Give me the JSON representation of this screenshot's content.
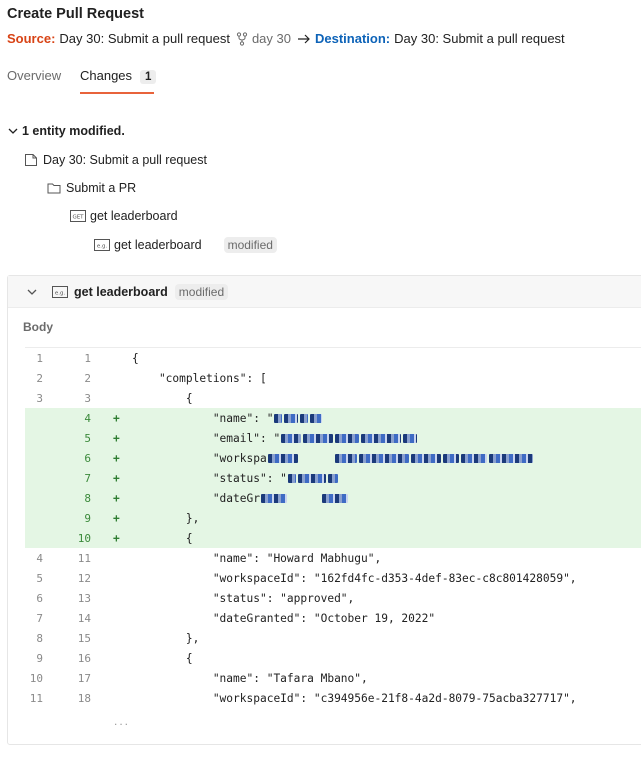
{
  "header": {
    "title": "Create Pull Request",
    "source_label": "Source:",
    "source_value": "Day 30: Submit a pull request",
    "source_branch": "day 30",
    "destination_label": "Destination:",
    "destination_value": "Day 30: Submit a pull request"
  },
  "tabs": [
    {
      "label": "Overview"
    },
    {
      "label": "Changes",
      "count": "1"
    }
  ],
  "tree": {
    "summary": "1 entity modified.",
    "collection": "Day 30: Submit a pull request",
    "folder": "Submit a PR",
    "request": "get leaderboard",
    "example": "get leaderboard",
    "example_status": "modified"
  },
  "panel": {
    "name": "get leaderboard",
    "status": "modified",
    "body_label": "Body",
    "ellipsis": "...",
    "lines": [
      {
        "old": "1",
        "new": "1",
        "sign": "",
        "code": "{"
      },
      {
        "old": "2",
        "new": "2",
        "sign": "",
        "code": "    \"completions\": ["
      },
      {
        "old": "3",
        "new": "3",
        "sign": "",
        "code": "        {"
      },
      {
        "old": "",
        "new": "4",
        "sign": "+",
        "code": "            \"name\": \""
      },
      {
        "old": "",
        "new": "5",
        "sign": "+",
        "code": "            \"email\": \""
      },
      {
        "old": "",
        "new": "6",
        "sign": "+",
        "code": "            \"workspa"
      },
      {
        "old": "",
        "new": "7",
        "sign": "+",
        "code": "            \"status\": \""
      },
      {
        "old": "",
        "new": "8",
        "sign": "+",
        "code": "            \"dateGr"
      },
      {
        "old": "",
        "new": "9",
        "sign": "+",
        "code": "        },"
      },
      {
        "old": "",
        "new": "10",
        "sign": "+",
        "code": "        {"
      },
      {
        "old": "4",
        "new": "11",
        "sign": "",
        "code": "            \"name\": \"Howard Mabhugu\","
      },
      {
        "old": "5",
        "new": "12",
        "sign": "",
        "code": "            \"workspaceId\": \"162fd4fc-d353-4def-83ec-c8c801428059\","
      },
      {
        "old": "6",
        "new": "13",
        "sign": "",
        "code": "            \"status\": \"approved\","
      },
      {
        "old": "7",
        "new": "14",
        "sign": "",
        "code": "            \"dateGranted\": \"October 19, 2022\""
      },
      {
        "old": "8",
        "new": "15",
        "sign": "",
        "code": "        },"
      },
      {
        "old": "9",
        "new": "16",
        "sign": "",
        "code": "        {"
      },
      {
        "old": "10",
        "new": "17",
        "sign": "",
        "code": "            \"name\": \"Tafara Mbano\","
      },
      {
        "old": "11",
        "new": "18",
        "sign": "",
        "code": "            \"workspaceId\": \"c394956e-21f8-4a2d-8079-75acba327717\","
      }
    ]
  },
  "colors": {
    "accent": "#e8633b",
    "source": "#d84315",
    "destination": "#0d63b8",
    "added_bg": "#e4f6e4"
  }
}
